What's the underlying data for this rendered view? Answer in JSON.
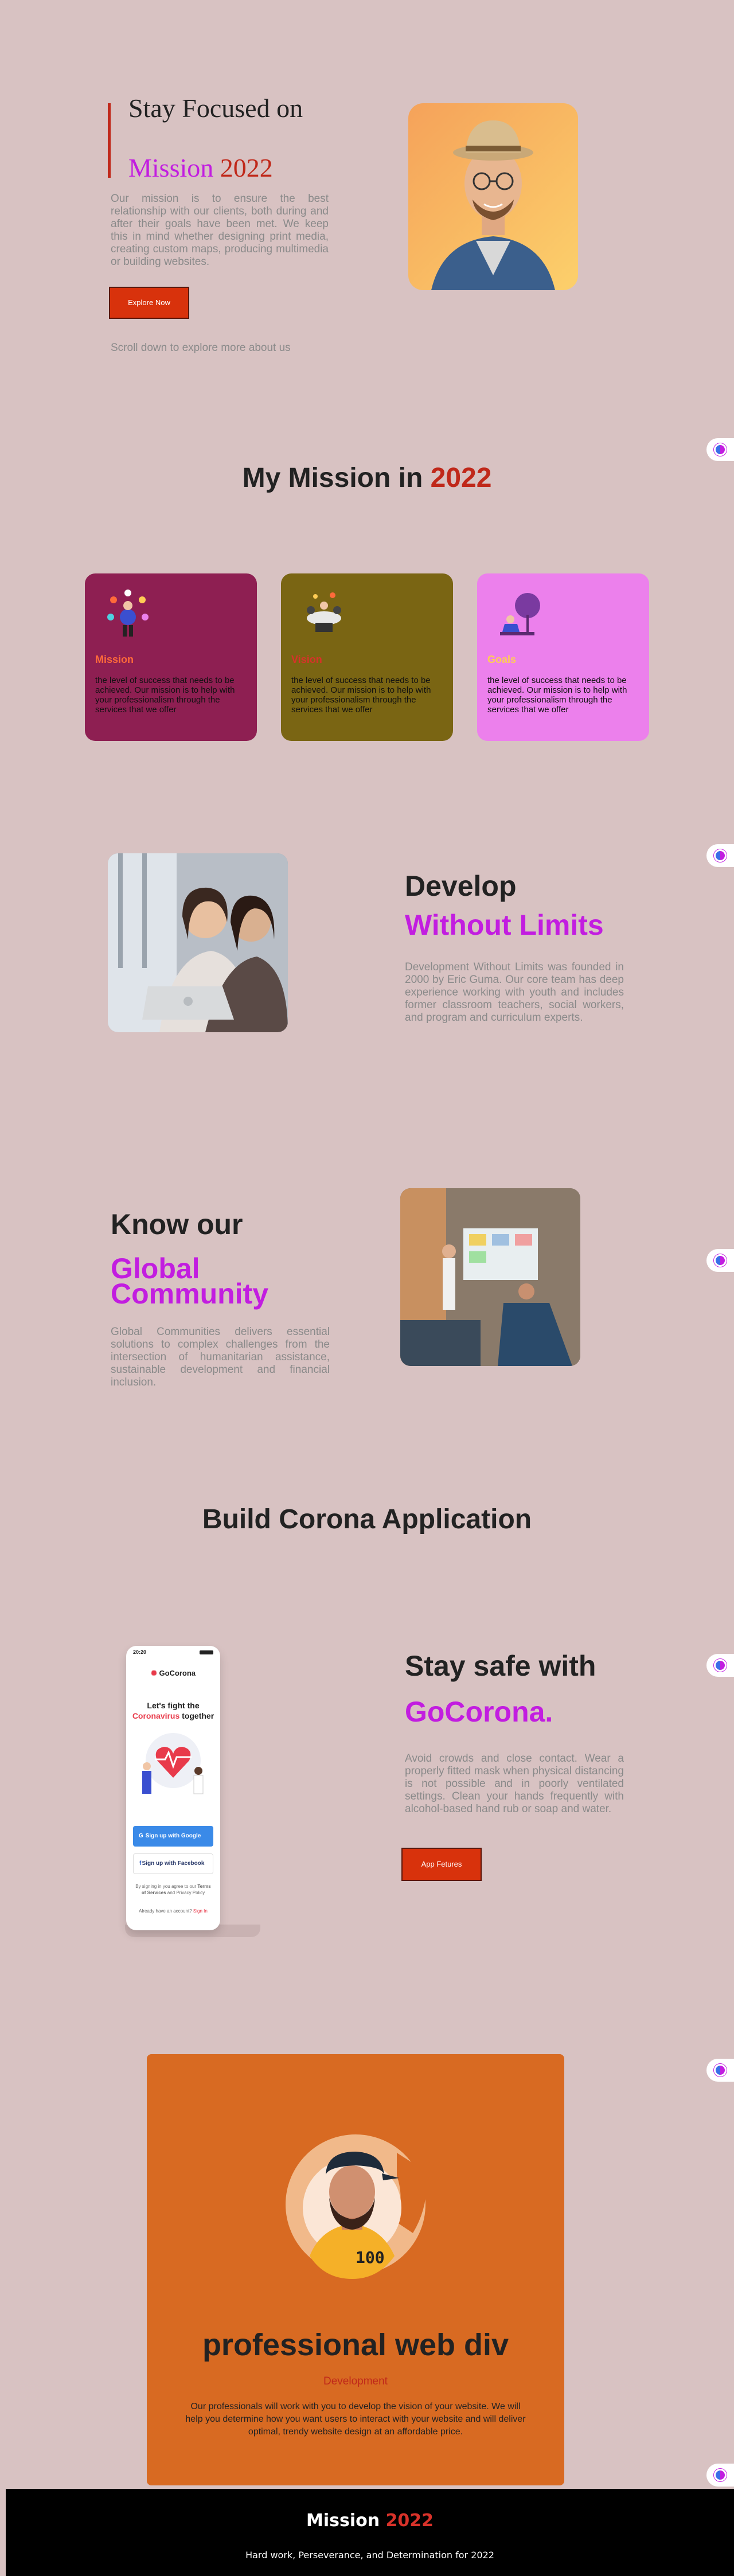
{
  "hero": {
    "line1": "Stay Focused on",
    "line2_prefix": "Mission ",
    "line2_year": "2022",
    "paragraph": "Our mission is to ensure the best relationship with our clients, both during and after their goals have been met. We keep this in mind whether designing print media, creating custom maps, producing multimedia or building websites.",
    "button": "Explore Now",
    "scroll_hint": "Scroll down to explore more about us"
  },
  "mission": {
    "title_prefix": "My Mission in ",
    "title_year": "2022",
    "cards": [
      {
        "title": "Mission",
        "text": "the level of success that needs to be achieved. Our mission is to help with your professionalism through the services that we offer",
        "bg": "#8e1f52",
        "title_color": "#ff6a3a"
      },
      {
        "title": "Vision",
        "text": "the level of success that needs to be achieved. Our mission is to help with your professionalism through the services that we offer",
        "bg": "#7a6513",
        "title_color": "#d8322a"
      },
      {
        "title": "Goals",
        "text": "the level of success that needs to be achieved. Our mission is to help with your professionalism through the services that we offer",
        "bg": "#ec80ec",
        "title_color": "#ffcc55"
      }
    ]
  },
  "develop": {
    "title1": "Develop",
    "title2": "Without Limits",
    "paragraph": "Development Without Limits was founded in 2000 by Eric Guma. Our core team has deep experience working with youth and includes former classroom teachers, social workers, and program and curriculum experts."
  },
  "know": {
    "title1": "Know our",
    "title2_a": "Global",
    "title2_b": "Community",
    "paragraph": "Global Communities delivers essential solutions to complex challenges from the intersection of humanitarian assistance, sustainable development and financial inclusion."
  },
  "corona": {
    "section_title": "Build Corona Application",
    "title1": "Stay safe with",
    "title2": "GoCorona.",
    "paragraph": "Avoid crowds and close contact. Wear a properly fitted mask when physical distancing is not possible and in poorly ventilated settings. Clean your hands frequently with alcohol-based hand rub or soap and water.",
    "button": "App Fetures",
    "phone": {
      "time": "20:20",
      "brand": "GoCorona",
      "headline1": "Let's fight the",
      "headline2a": "Coronavirus",
      "headline2b": " together",
      "google_btn": "Sign up with Google",
      "facebook_btn": "Sign up with Facebook",
      "terms_a": "By signing in you agree to our ",
      "terms_b": "Terms of Services",
      "terms_c": " and Privacy Policy",
      "account_q": "Already have an account? ",
      "signin": "Sign In"
    }
  },
  "profile": {
    "name": "professional web div",
    "role": "Development",
    "description": "Our professionals will work with you to develop the vision of your website. We will help you determine how you want users to interact with your website and will deliver optimal, trendy website design at an affordable price."
  },
  "footer": {
    "brand": "Mission ",
    "year": "2022",
    "tagline": "Hard work, Perseverance, and Determination for 2022"
  }
}
